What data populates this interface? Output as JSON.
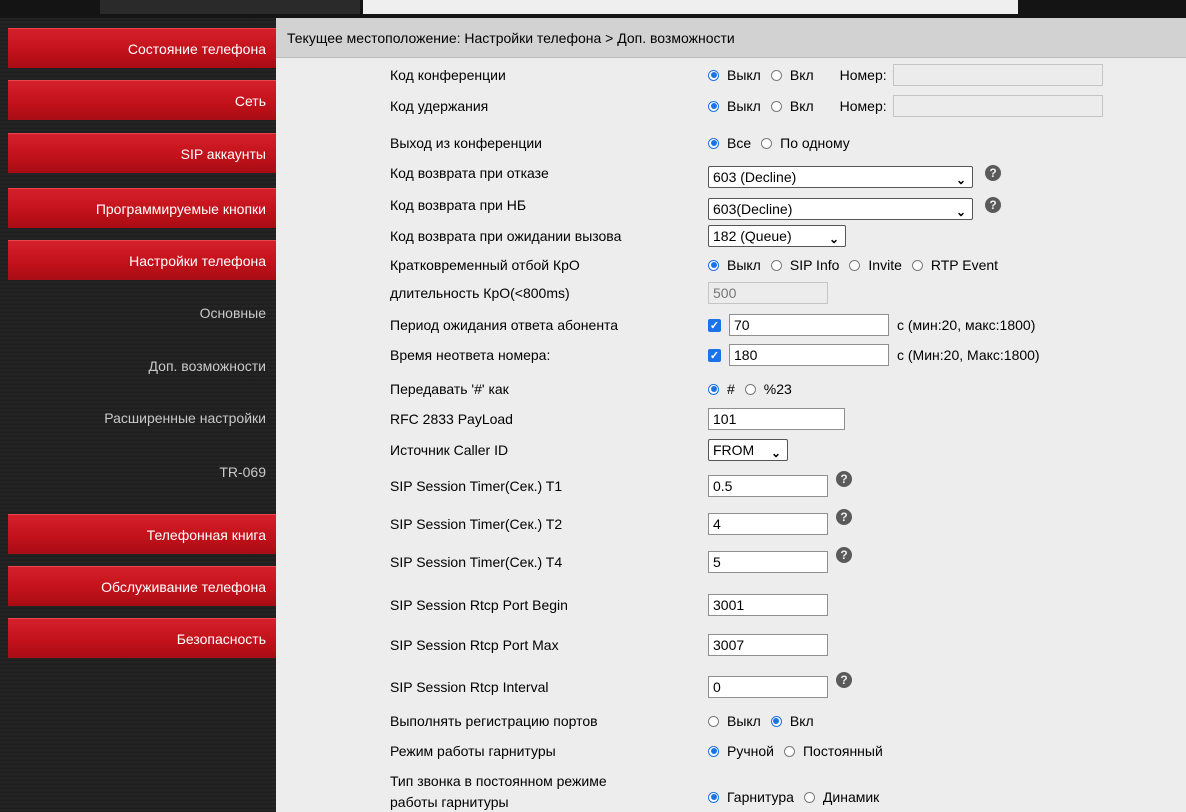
{
  "sidebar": {
    "items": [
      {
        "label": "Состояние телефона",
        "type": "red"
      },
      {
        "label": "Сеть",
        "type": "red"
      },
      {
        "label": "SIP аккаунты",
        "type": "red"
      },
      {
        "label": "Программируемые кнопки",
        "type": "red"
      },
      {
        "label": "Настройки телефона",
        "type": "red"
      },
      {
        "label": "Основные",
        "type": "sub"
      },
      {
        "label": "Доп. возможности",
        "type": "sub"
      },
      {
        "label": "Расширенные настройки",
        "type": "sub"
      },
      {
        "label": "TR-069",
        "type": "sub"
      },
      {
        "label": "Телефонная книга",
        "type": "red"
      },
      {
        "label": "Обслуживание телефона",
        "type": "red"
      },
      {
        "label": "Безопасность",
        "type": "red"
      }
    ]
  },
  "breadcrumb": "Текущее местоположение: Настройки телефона > Доп. возможности",
  "form": {
    "conf_code": {
      "label": "Код конференции",
      "off": "Выкл",
      "on": "Вкл",
      "number_label": "Номер:",
      "number_value": ""
    },
    "hold_code": {
      "label": "Код удержания",
      "off": "Выкл",
      "on": "Вкл",
      "number_label": "Номер:",
      "number_value": ""
    },
    "conf_exit": {
      "label": "Выход из конференции",
      "opt_all": "Все",
      "opt_one": "По одному"
    },
    "reject_code": {
      "label": "Код возврата при отказе",
      "value": "603 (Decline)"
    },
    "dnd_code": {
      "label": "Код возврата при НБ",
      "value": "603(Decline)"
    },
    "wait_code": {
      "label": "Код возврата при ожидании вызова",
      "value": "182 (Queue)"
    },
    "flash": {
      "label": "Кратковременный отбой КрО",
      "opt_off": "Выкл",
      "opt_sipinfo": "SIP Info",
      "opt_invite": "Invite",
      "opt_rtp": "RTP Event"
    },
    "flash_duration": {
      "label": "длительность КрО(<800ms)",
      "value": "500"
    },
    "answer_wait": {
      "label": "Период ожидания ответа абонента",
      "value": "70",
      "unit": "с (мин:20, макс:1800)"
    },
    "no_answer": {
      "label": "Время неответа номера:",
      "value": "180",
      "unit": "с (Мин:20, Макс:1800)"
    },
    "hash_as": {
      "label": "Передавать '#' как",
      "opt_hash": "#",
      "opt_23": "%23"
    },
    "rfc2833": {
      "label": "RFC 2833 PayLoad",
      "value": "101"
    },
    "callerid_src": {
      "label": "Источник Caller ID",
      "value": "FROM"
    },
    "t1": {
      "label": "SIP Session Timer(Сек.) T1",
      "value": "0.5"
    },
    "t2": {
      "label": "SIP Session Timer(Сек.) T2",
      "value": "4"
    },
    "t4": {
      "label": "SIP Session Timer(Сек.) T4",
      "value": "5"
    },
    "rtcp_begin": {
      "label": "SIP Session Rtcp Port Begin",
      "value": "3001"
    },
    "rtcp_max": {
      "label": "SIP Session Rtcp Port Max",
      "value": "3007"
    },
    "rtcp_interval": {
      "label": "SIP Session Rtcp Interval",
      "value": "0"
    },
    "port_reg": {
      "label": "Выполнять регистрацию портов",
      "off": "Выкл",
      "on": "Вкл"
    },
    "headset_mode": {
      "label": "Режим работы гарнитуры",
      "opt_manual": "Ручной",
      "opt_const": "Постоянный"
    },
    "ring_type": {
      "label_l1": "Тип звонка в постоянном режиме",
      "label_l2": "работы гарнитуры",
      "opt_headset": "Гарнитура",
      "opt_speaker": "Динамик"
    }
  },
  "help_glyph": "?",
  "check_glyph": "✓",
  "chevron_glyph": "⌄"
}
